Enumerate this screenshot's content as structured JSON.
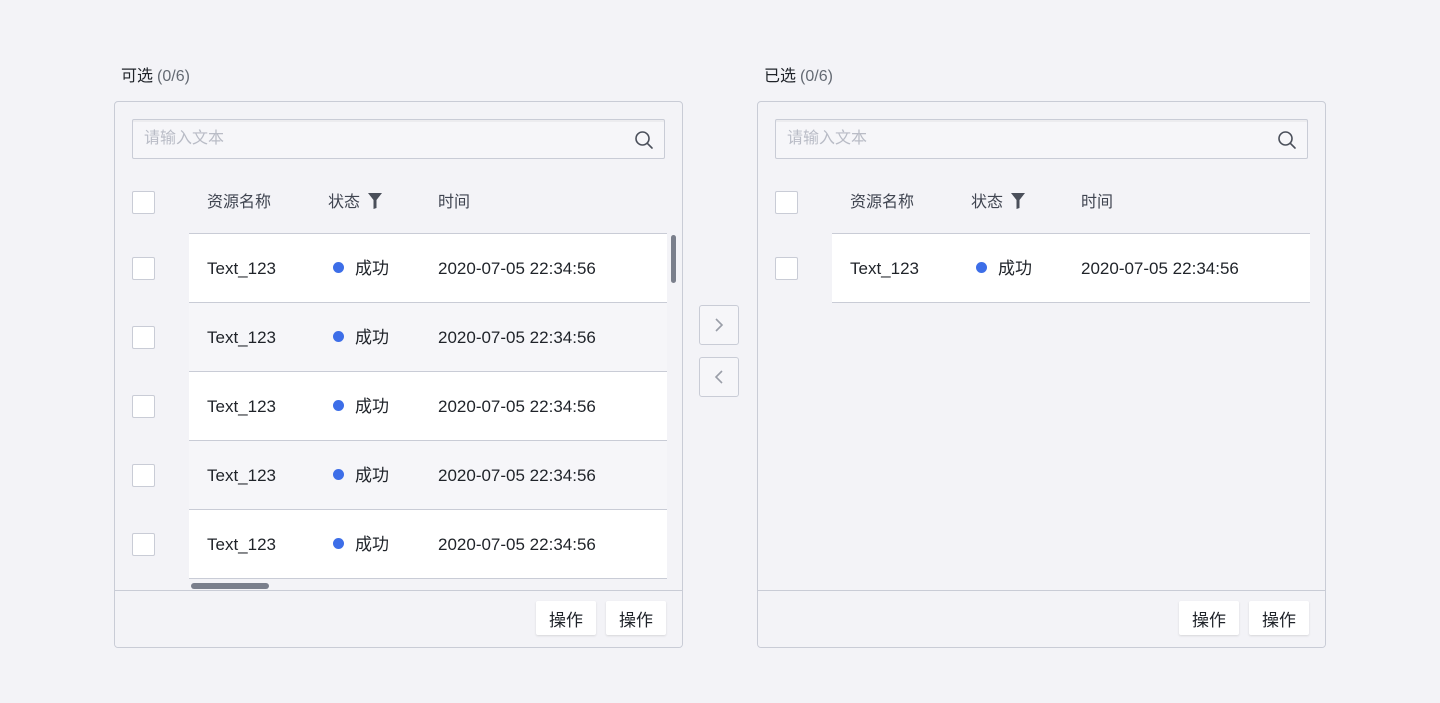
{
  "left_panel": {
    "title": "可选",
    "count": "(0/6)",
    "search_placeholder": "请输入文本",
    "columns": {
      "name": "资源名称",
      "status": "状态",
      "time": "时间"
    },
    "rows": [
      {
        "name": "Text_123",
        "status": "成功",
        "time": "2020-07-05 22:34:56"
      },
      {
        "name": "Text_123",
        "status": "成功",
        "time": "2020-07-05 22:34:56"
      },
      {
        "name": "Text_123",
        "status": "成功",
        "time": "2020-07-05 22:34:56"
      },
      {
        "name": "Text_123",
        "status": "成功",
        "time": "2020-07-05 22:34:56"
      },
      {
        "name": "Text_123",
        "status": "成功",
        "time": "2020-07-05 22:34:56"
      }
    ],
    "footer_buttons": [
      "操作",
      "操作"
    ]
  },
  "right_panel": {
    "title": "已选",
    "count": "(0/6)",
    "search_placeholder": "请输入文本",
    "columns": {
      "name": "资源名称",
      "status": "状态",
      "time": "时间"
    },
    "rows": [
      {
        "name": "Text_123",
        "status": "成功",
        "time": "2020-07-05 22:34:56"
      }
    ],
    "footer_buttons": [
      "操作",
      "操作"
    ]
  },
  "transfer": {
    "right_icon": "chevron-right-icon",
    "left_icon": "chevron-left-icon"
  },
  "colors": {
    "status_success": "#3d6ee8",
    "border": "#c9ccd6",
    "background": "#f3f3f7"
  }
}
